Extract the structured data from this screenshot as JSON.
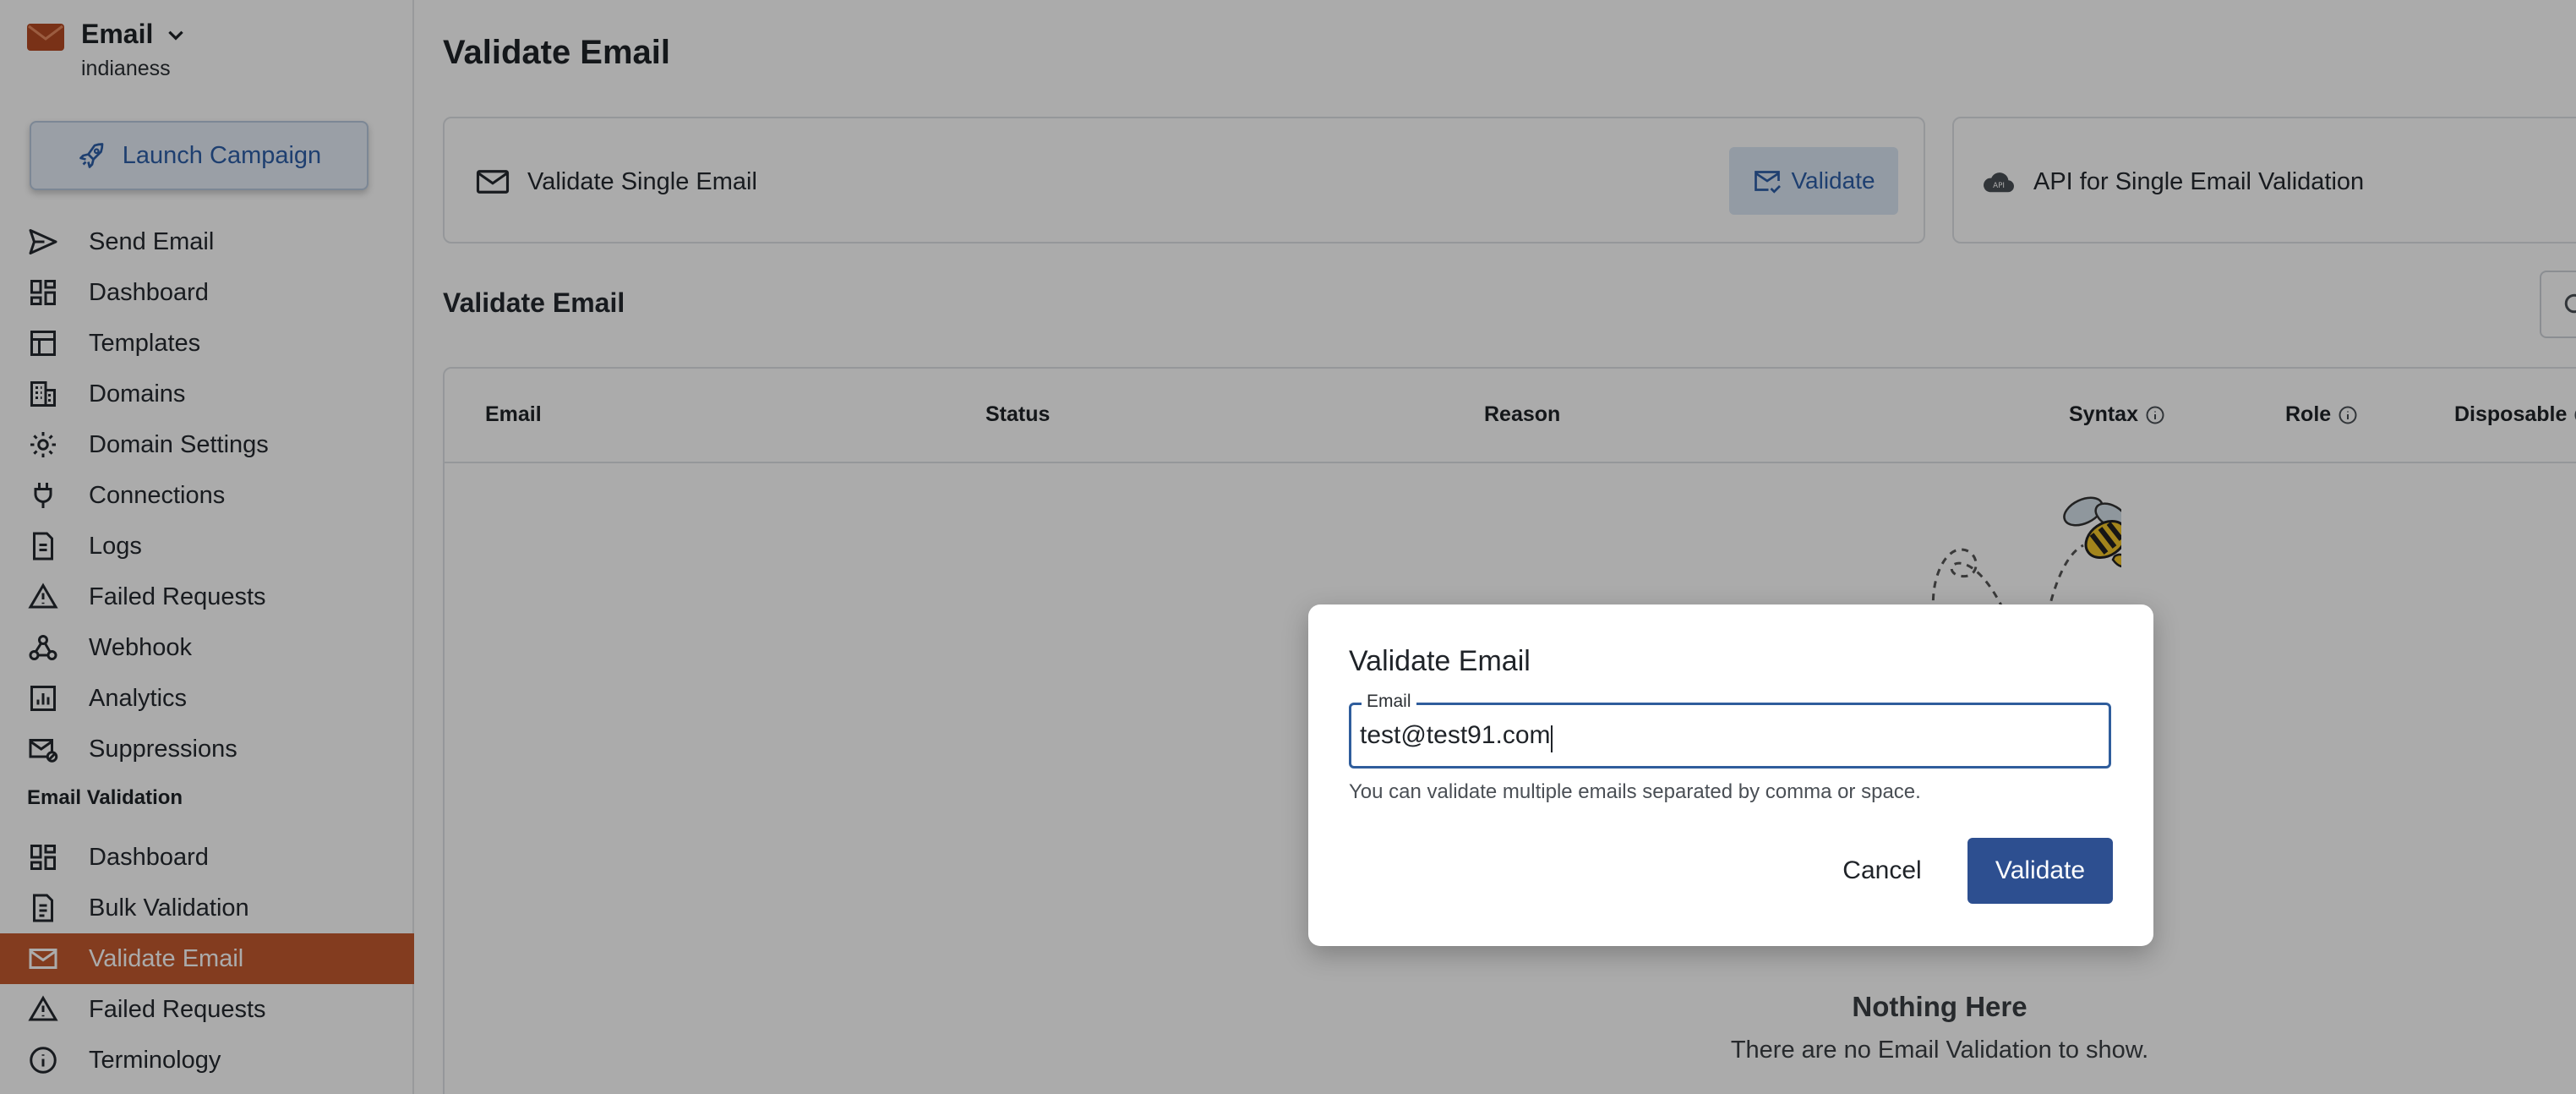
{
  "colors": {
    "accent": "#c45a2f",
    "primary": "#2d4f90",
    "link": "#2e5fa8"
  },
  "app": {
    "name": "Email",
    "account": "indianess"
  },
  "sidebar": {
    "launch_label": "Launch Campaign",
    "items": [
      {
        "label": "Send Email",
        "icon": "send-icon"
      },
      {
        "label": "Dashboard",
        "icon": "dashboard-icon"
      },
      {
        "label": "Templates",
        "icon": "templates-icon"
      },
      {
        "label": "Domains",
        "icon": "building-icon"
      },
      {
        "label": "Domain Settings",
        "icon": "gear-icon"
      },
      {
        "label": "Connections",
        "icon": "plug-icon"
      },
      {
        "label": "Logs",
        "icon": "document-icon"
      },
      {
        "label": "Failed Requests",
        "icon": "warning-icon"
      },
      {
        "label": "Webhook",
        "icon": "webhook-icon"
      },
      {
        "label": "Analytics",
        "icon": "analytics-icon"
      },
      {
        "label": "Suppressions",
        "icon": "suppression-icon"
      }
    ],
    "section_label": "Email Validation",
    "validation_items": [
      {
        "label": "Dashboard",
        "icon": "dashboard-icon"
      },
      {
        "label": "Bulk Validation",
        "icon": "document-list-icon"
      },
      {
        "label": "Validate Email",
        "icon": "mail-icon",
        "active": true
      },
      {
        "label": "Failed Requests",
        "icon": "warning-icon"
      },
      {
        "label": "Terminology",
        "icon": "info-icon"
      }
    ]
  },
  "main": {
    "title": "Validate Email",
    "single_card": {
      "label": "Validate Single Email",
      "button": "Validate"
    },
    "api_card": {
      "label": "API for Single Email Validation"
    },
    "subheading": "Validate Email",
    "table": {
      "columns": [
        "Email",
        "Status",
        "Reason",
        "Syntax",
        "Role",
        "Disposable"
      ]
    },
    "empty": {
      "title": "Nothing Here",
      "subtitle": "There are no Email Validation to show."
    }
  },
  "modal": {
    "title": "Validate Email",
    "field_label": "Email",
    "field_value": "test@test91.com",
    "helper": "You can validate multiple emails separated by comma or space.",
    "cancel": "Cancel",
    "submit": "Validate"
  }
}
